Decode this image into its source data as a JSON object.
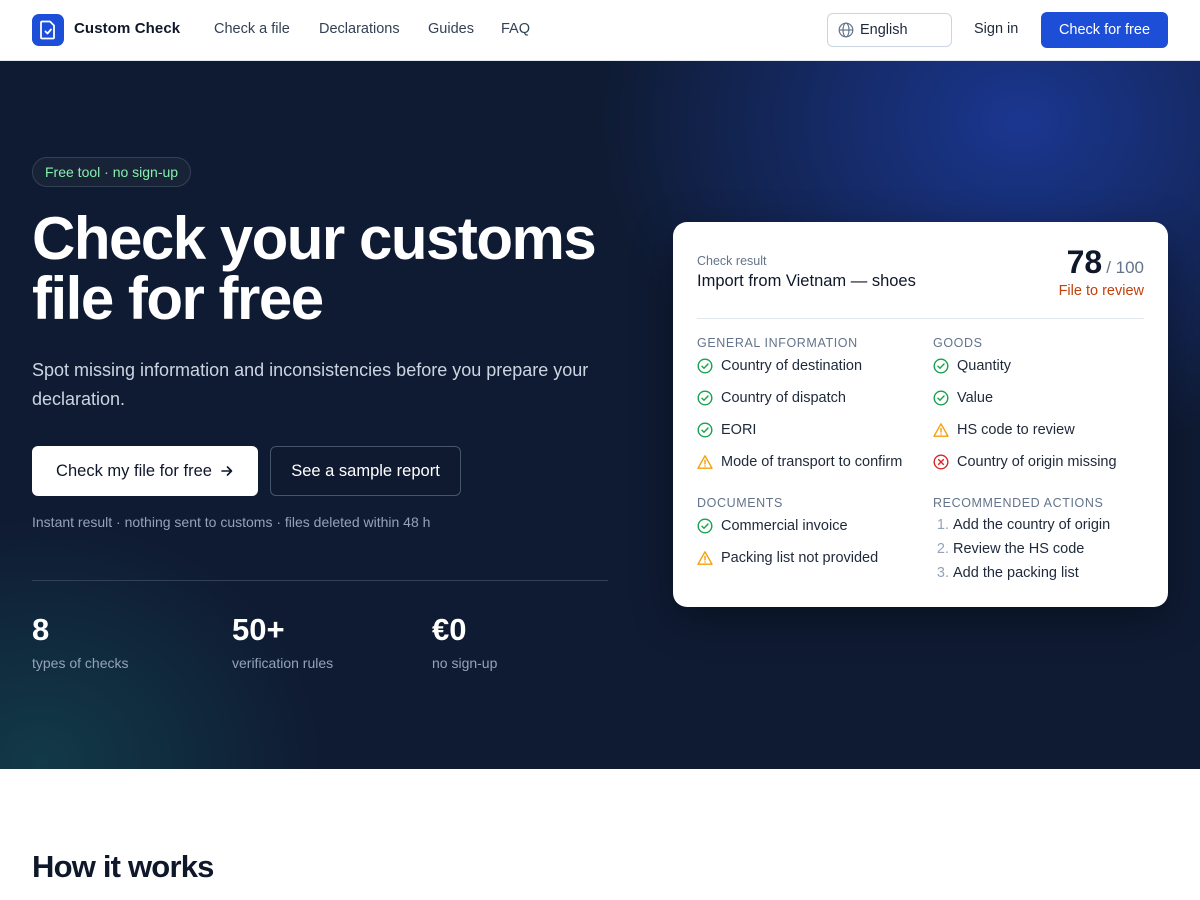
{
  "header": {
    "brand": "Custom Check",
    "nav": [
      "Check a file",
      "Declarations",
      "Guides",
      "FAQ"
    ],
    "language": "English",
    "signin": "Sign in",
    "cta": "Check for free"
  },
  "hero": {
    "badge": "Free tool · no sign-up",
    "title_line1": "Check your customs",
    "title_line2": "file for free",
    "subtitle": "Spot missing information and inconsistencies before you prepare your declaration.",
    "primary_button": "Check my file for free",
    "secondary_button": "See a sample report",
    "note": "Instant result · nothing sent to customs · files deleted within 48 h",
    "stats": [
      {
        "value": "8",
        "label": "types of checks"
      },
      {
        "value": "50+",
        "label": "verification rules"
      },
      {
        "value": "€0",
        "label": "no sign-up"
      }
    ]
  },
  "card": {
    "kicker": "Check result",
    "title": "Import from Vietnam — shoes",
    "score": "78",
    "score_max": "/ 100",
    "status": "File to review",
    "sections": {
      "general": {
        "heading": "General information",
        "items": [
          {
            "label": "Country of destination",
            "state": "ok"
          },
          {
            "label": "Country of dispatch",
            "state": "ok"
          },
          {
            "label": "EORI",
            "state": "ok"
          },
          {
            "label": "Mode of transport to confirm",
            "state": "warn"
          }
        ]
      },
      "goods": {
        "heading": "Goods",
        "items": [
          {
            "label": "Quantity",
            "state": "ok"
          },
          {
            "label": "Value",
            "state": "ok"
          },
          {
            "label": "HS code to review",
            "state": "warn"
          },
          {
            "label": "Country of origin missing",
            "state": "error"
          }
        ]
      },
      "documents": {
        "heading": "Documents",
        "items": [
          {
            "label": "Commercial invoice",
            "state": "ok"
          },
          {
            "label": "Packing list not provided",
            "state": "warn"
          }
        ]
      },
      "actions": {
        "heading": "Recommended actions",
        "items": [
          {
            "num": "1.",
            "label": "Add the country of origin"
          },
          {
            "num": "2.",
            "label": "Review the HS code"
          },
          {
            "num": "3.",
            "label": "Add the packing list"
          }
        ]
      }
    }
  },
  "section2": {
    "title": "How it works"
  },
  "colors": {
    "accent": "#1d4ed8",
    "ok": "#16a34a",
    "warn": "#f59e0b",
    "error": "#dc2626",
    "hero_bg": "#0f1b33"
  }
}
